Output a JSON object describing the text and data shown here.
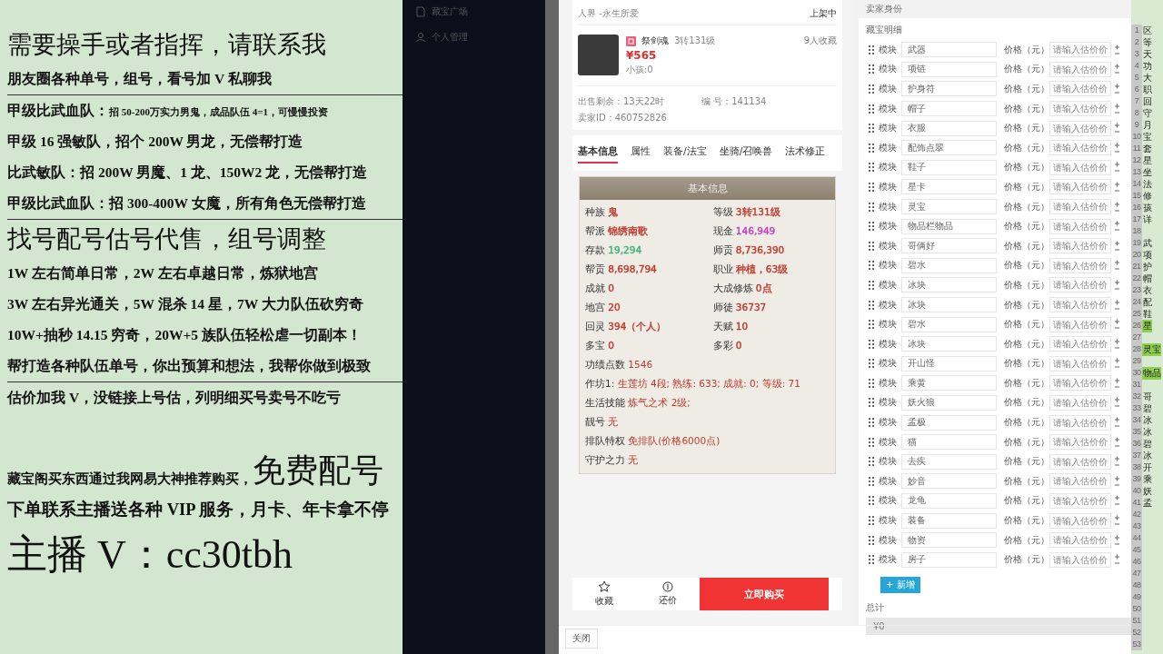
{
  "promo": [
    {
      "kind": "big",
      "text": "需要操手或者指挥，请联系我",
      "divider": false
    },
    {
      "kind": "normal",
      "text": "朋友圈各种单号，组号，看号加 V 私聊我",
      "divider": true
    },
    {
      "kind": "mixed",
      "lead": "甲级比武血队：",
      "text": "招 50-200万实力男鬼，成品队伍 4=1，可慢慢投资",
      "divider": false
    },
    {
      "kind": "normal",
      "text": "甲级 16 强敏队，招个 200W 男龙，无偿帮打造",
      "divider": false
    },
    {
      "kind": "normal",
      "text": "比武敏队：招 200W 男魔、1 龙、150W2 龙，无偿帮打造",
      "divider": false
    },
    {
      "kind": "normal",
      "text": "甲级比武血队：招 300-400W 女魔，所有角色无偿帮打造",
      "divider": true
    },
    {
      "kind": "big",
      "text": "找号配号估号代售，组号调整",
      "divider": false
    },
    {
      "kind": "normal",
      "text": "1W 左右简单日常，2W 左右卓越日常，炼狱地宫",
      "divider": false
    },
    {
      "kind": "normal",
      "text": "3W 左右异光通关，5W 混杀 14 星，7W 大力队伍砍穷奇",
      "divider": false
    },
    {
      "kind": "normal",
      "text": "10W+抽秒 14.15 穷奇，20W+5 族队伍轻松虐一切副本！",
      "divider": false
    },
    {
      "kind": "normal",
      "text": "帮打造各种队伍单号，你出预算和想法，我帮你做到极致",
      "divider": true
    },
    {
      "kind": "normal",
      "text": "估价加我 V，没链接上号估，列明细买号卖号不吃亏",
      "divider": false
    },
    {
      "kind": "tail",
      "lead": "藏宝阁买东西通过我网易大神推荐购买，",
      "text": "免费配号",
      "divider": false
    },
    {
      "kind": "wide",
      "text": "下单联系主播送各种 VIP 服务，月卡、年卡拿不停",
      "divider": false
    },
    {
      "kind": "huge",
      "text": "主播 V：cc30tbh",
      "divider": false
    }
  ],
  "sidebar": {
    "items": [
      {
        "label": "藏宝广场",
        "kind": "doc"
      },
      {
        "label": "个人管理",
        "kind": "user"
      }
    ]
  },
  "listing": {
    "server": "人界 -永生所爱",
    "status": "上架中",
    "name": "祭剑魂",
    "level": "3转131级",
    "favorites": "9人收藏",
    "price": "¥565",
    "kids": "小孩:0",
    "remaining": "出售剩余：13天22时",
    "serial": "编 号：141134",
    "seller": "卖家ID：460752826",
    "tabs": [
      {
        "label": "基本信息",
        "selected": true
      },
      {
        "label": "属性",
        "selected": false
      },
      {
        "label": "装备/法宝",
        "selected": false
      },
      {
        "label": "坐骑/召唤兽",
        "selected": false
      },
      {
        "label": "法术修正",
        "selected": false
      }
    ],
    "card_title": "基本信息",
    "stats": [
      {
        "label": "种族",
        "value": "鬼",
        "color": "#c0392b"
      },
      {
        "label": "等级",
        "value": "3转131级",
        "color": "#c0392b"
      },
      {
        "label": "帮派",
        "value": "锦绣南歌",
        "color": "#c0392b"
      },
      {
        "label": "现金",
        "value": "146,949",
        "color": "#c040c0"
      },
      {
        "label": "存款",
        "value": "19,294",
        "color": "#3cb371"
      },
      {
        "label": "师贡",
        "value": "8,736,390",
        "color": "#c0392b"
      },
      {
        "label": "帮贡",
        "value": "8,698,794",
        "color": "#c0392b"
      },
      {
        "label": "职业",
        "value": "种植，63级",
        "color": "#c0392b"
      },
      {
        "label": "成就",
        "value": "0",
        "color": "#c0392b"
      },
      {
        "label": "大成修炼",
        "value": "0点",
        "color": "#c0392b"
      },
      {
        "label": "地宫",
        "value": "20",
        "color": "#c0392b"
      },
      {
        "label": "师徒",
        "value": "36737",
        "color": "#c0392b"
      },
      {
        "label": "回灵",
        "value": "394（个人）",
        "color": "#c0392b"
      },
      {
        "label": "天赋",
        "value": "10",
        "color": "#c0392b"
      },
      {
        "label": "多宝",
        "value": "0",
        "color": "#c0392b"
      },
      {
        "label": "多彩",
        "value": "0",
        "color": "#c0392b"
      }
    ],
    "wide_stats": [
      {
        "label": "功绩点数",
        "value": "1546"
      },
      {
        "label": "作坊1:",
        "value": "生莲坊 4段; 熟练: 633; 成就: 0; 等级: 71"
      },
      {
        "label": "生活技能",
        "value": "炼气之术 2级;"
      },
      {
        "label": "靓号",
        "value": "无"
      },
      {
        "label": "排队特权",
        "value": "免排队(价格6000点)"
      },
      {
        "label": "守护之力",
        "value": "无"
      }
    ],
    "actions": [
      {
        "label": "收藏",
        "kind": "star"
      },
      {
        "label": "还价",
        "kind": "bargain"
      }
    ],
    "buy": "立即购买"
  },
  "form": {
    "header": "卖家身份",
    "section": "藏宝明细",
    "items": [
      {
        "module_label": "模块",
        "value": "武器",
        "price_label": "价格（元）",
        "placeholder": "请输入估价价"
      },
      {
        "module_label": "模块",
        "value": "项链",
        "price_label": "价格（元）",
        "placeholder": "请输入估价价"
      },
      {
        "module_label": "模块",
        "value": "护身符",
        "price_label": "价格（元）",
        "placeholder": "请输入估价价"
      },
      {
        "module_label": "模块",
        "value": "帽子",
        "price_label": "价格（元）",
        "placeholder": "请输入估价价"
      },
      {
        "module_label": "模块",
        "value": "衣服",
        "price_label": "价格（元）",
        "placeholder": "请输入估价价"
      },
      {
        "module_label": "模块",
        "value": "配饰点翠",
        "price_label": "价格（元）",
        "placeholder": "请输入估价价"
      },
      {
        "module_label": "模块",
        "value": "鞋子",
        "price_label": "价格（元）",
        "placeholder": "请输入估价价"
      },
      {
        "module_label": "模块",
        "value": "星卡",
        "price_label": "价格（元）",
        "placeholder": "请输入估价价"
      },
      {
        "module_label": "模块",
        "value": "灵宝",
        "price_label": "价格（元）",
        "placeholder": "请输入估价价"
      },
      {
        "module_label": "模块",
        "value": "物品栏物品",
        "price_label": "价格（元）",
        "placeholder": "请输入估价价"
      },
      {
        "module_label": "模块",
        "value": "哥俩好",
        "price_label": "价格（元）",
        "placeholder": "请输入估价价"
      },
      {
        "module_label": "模块",
        "value": "碧水",
        "price_label": "价格（元）",
        "placeholder": "请输入估价价"
      },
      {
        "module_label": "模块",
        "value": "冰块",
        "price_label": "价格（元）",
        "placeholder": "请输入估价价"
      },
      {
        "module_label": "模块",
        "value": "冰块",
        "price_label": "价格（元）",
        "placeholder": "请输入估价价"
      },
      {
        "module_label": "模块",
        "value": "碧水",
        "price_label": "价格（元）",
        "placeholder": "请输入估价价"
      },
      {
        "module_label": "模块",
        "value": "冰块",
        "price_label": "价格（元）",
        "placeholder": "请输入估价价"
      },
      {
        "module_label": "模块",
        "value": "开山怪",
        "price_label": "价格（元）",
        "placeholder": "请输入估价价"
      },
      {
        "module_label": "模块",
        "value": "乘黄",
        "price_label": "价格（元）",
        "placeholder": "请输入估价价"
      },
      {
        "module_label": "模块",
        "value": "妖火狼",
        "price_label": "价格（元）",
        "placeholder": "请输入估价价"
      },
      {
        "module_label": "模块",
        "value": "孟极",
        "price_label": "价格（元）",
        "placeholder": "请输入估价价"
      },
      {
        "module_label": "模块",
        "value": "猫",
        "price_label": "价格（元）",
        "placeholder": "请输入估价价"
      },
      {
        "module_label": "模块",
        "value": "去疾",
        "price_label": "价格（元）",
        "placeholder": "请输入估价价"
      },
      {
        "module_label": "模块",
        "value": "妙音",
        "price_label": "价格（元）",
        "placeholder": "请输入估价价"
      },
      {
        "module_label": "模块",
        "value": "龙龟",
        "price_label": "价格（元）",
        "placeholder": "请输入估价价"
      },
      {
        "module_label": "模块",
        "value": "装备",
        "price_label": "价格（元）",
        "placeholder": "请输入估价价"
      },
      {
        "module_label": "模块",
        "value": "物资",
        "price_label": "价格（元）",
        "placeholder": "请输入估价价"
      },
      {
        "module_label": "模块",
        "value": "房子",
        "price_label": "价格（元）",
        "placeholder": "请输入估价价"
      }
    ],
    "add": "+ 新增",
    "total_label": "总计",
    "total": "¥0"
  },
  "close": "关闭",
  "editor": {
    "lines": [
      {
        "n": "1",
        "text": "区",
        "highlight": false
      },
      {
        "n": "2",
        "text": "等",
        "highlight": false
      },
      {
        "n": "3",
        "text": "天",
        "highlight": false
      },
      {
        "n": "4",
        "text": "功",
        "highlight": false
      },
      {
        "n": "5",
        "text": "大",
        "highlight": false
      },
      {
        "n": "6",
        "text": "职",
        "highlight": false
      },
      {
        "n": "7",
        "text": "回",
        "highlight": false
      },
      {
        "n": "8",
        "text": "守",
        "highlight": false
      },
      {
        "n": "9",
        "text": "月",
        "highlight": false
      },
      {
        "n": "10",
        "text": "宝",
        "highlight": false
      },
      {
        "n": "11",
        "text": "套",
        "highlight": false
      },
      {
        "n": "12",
        "text": "星",
        "highlight": false
      },
      {
        "n": "13",
        "text": "坐",
        "highlight": false
      },
      {
        "n": "14",
        "text": "法",
        "highlight": false
      },
      {
        "n": "15",
        "text": "修",
        "highlight": false
      },
      {
        "n": "16",
        "text": "孩",
        "highlight": false
      },
      {
        "n": "17",
        "text": "详",
        "highlight": false
      },
      {
        "n": "18"
      },
      {
        "n": "19",
        "text": "武",
        "highlight": false
      },
      {
        "n": "20",
        "text": "项",
        "highlight": false
      },
      {
        "n": "21",
        "text": "护",
        "highlight": false
      },
      {
        "n": "22",
        "text": "帽",
        "highlight": false
      },
      {
        "n": "23",
        "text": "衣",
        "highlight": false
      },
      {
        "n": "24",
        "text": "配",
        "highlight": false
      },
      {
        "n": "25",
        "text": "鞋",
        "highlight": false
      },
      {
        "n": "26",
        "text": "星",
        "highlight": true
      },
      {
        "n": "27"
      },
      {
        "n": "28",
        "text": "灵宝",
        "highlight": true
      },
      {
        "n": "29"
      },
      {
        "n": "30",
        "text": "物品",
        "highlight": true
      },
      {
        "n": "31"
      },
      {
        "n": "32",
        "text": "哥",
        "highlight": false
      },
      {
        "n": "33",
        "text": "碧",
        "highlight": false
      },
      {
        "n": "34",
        "text": "冰",
        "highlight": false
      },
      {
        "n": "35",
        "text": "冰",
        "highlight": false
      },
      {
        "n": "36",
        "text": "碧",
        "highlight": false
      },
      {
        "n": "37",
        "text": "冰",
        "highlight": false
      },
      {
        "n": "38",
        "text": "开",
        "highlight": false
      },
      {
        "n": "39",
        "text": "乘",
        "highlight": false
      },
      {
        "n": "40",
        "text": "妖",
        "highlight": false
      },
      {
        "n": "41",
        "text": "孟",
        "highlight": false
      },
      {
        "n": "42"
      },
      {
        "n": "43"
      },
      {
        "n": "44"
      },
      {
        "n": "45"
      },
      {
        "n": "46"
      },
      {
        "n": "47"
      },
      {
        "n": "48"
      },
      {
        "n": "49"
      },
      {
        "n": "50"
      },
      {
        "n": "51"
      },
      {
        "n": "52"
      },
      {
        "n": "53"
      }
    ]
  }
}
